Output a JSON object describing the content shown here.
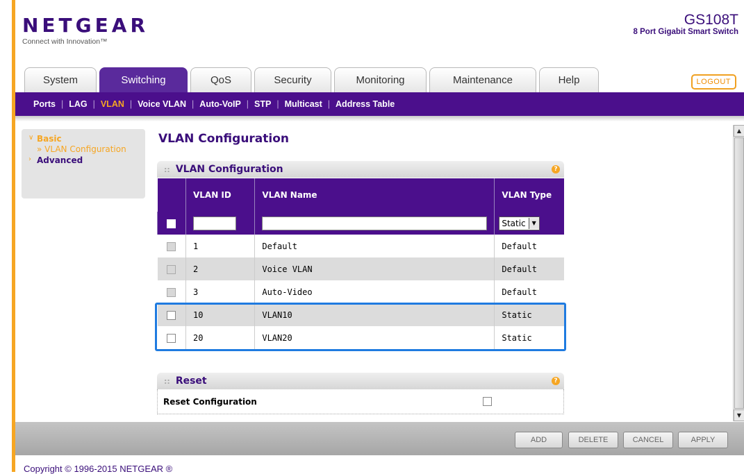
{
  "brand": {
    "logo": "NETGEAR",
    "tagline": "Connect with Innovation™",
    "model": "GS108T",
    "model_desc": "8 Port Gigabit Smart Switch"
  },
  "tabs": [
    {
      "label": "System",
      "active": false
    },
    {
      "label": "Switching",
      "active": true
    },
    {
      "label": "QoS",
      "active": false
    },
    {
      "label": "Security",
      "active": false
    },
    {
      "label": "Monitoring",
      "active": false
    },
    {
      "label": "Maintenance",
      "active": false
    },
    {
      "label": "Help",
      "active": false
    }
  ],
  "logout_label": "LOGOUT",
  "subnav": [
    {
      "label": "Ports",
      "active": false
    },
    {
      "label": "LAG",
      "active": false
    },
    {
      "label": "VLAN",
      "active": true
    },
    {
      "label": "Voice VLAN",
      "active": false
    },
    {
      "label": "Auto-VoIP",
      "active": false
    },
    {
      "label": "STP",
      "active": false
    },
    {
      "label": "Multicast",
      "active": false
    },
    {
      "label": "Address Table",
      "active": false
    }
  ],
  "sidebar": {
    "basic": "Basic",
    "vlan_config": "» VLAN Configuration",
    "advanced": "Advanced"
  },
  "page_title": "VLAN Configuration",
  "vlan_section": {
    "title": "VLAN Configuration",
    "columns": [
      "VLAN ID",
      "VLAN Name",
      "VLAN Type"
    ],
    "input": {
      "vlan_id": "",
      "vlan_name": "",
      "type_selected": "Static"
    },
    "rows": [
      {
        "id": "1",
        "name": "Default",
        "type": "Default"
      },
      {
        "id": "2",
        "name": "Voice VLAN",
        "type": "Default"
      },
      {
        "id": "3",
        "name": "Auto-Video",
        "type": "Default"
      },
      {
        "id": "10",
        "name": "VLAN10",
        "type": "Static"
      },
      {
        "id": "20",
        "name": "VLAN20",
        "type": "Static"
      }
    ]
  },
  "reset_section": {
    "title": "Reset",
    "label": "Reset Configuration"
  },
  "buttons": {
    "add": "ADD",
    "delete": "DELETE",
    "cancel": "CANCEL",
    "apply": "APPLY"
  },
  "copyright": "Copyright © 1996-2015 NETGEAR ®",
  "colors": {
    "brand_purple": "#4b0f8c",
    "accent_orange": "#f6a623",
    "highlight_blue": "#1f7be0"
  }
}
